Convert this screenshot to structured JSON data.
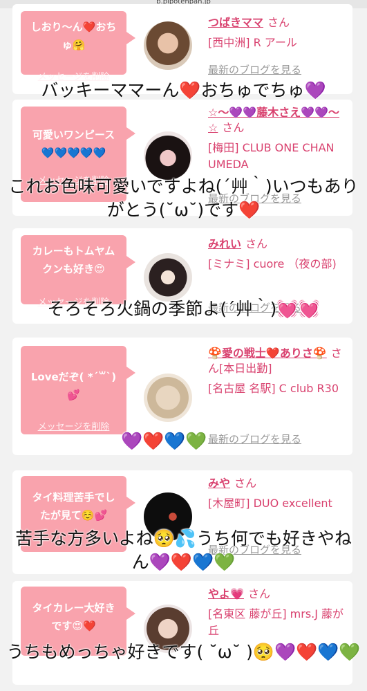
{
  "status": {
    "url_text": "b.pipotenpan.jp"
  },
  "blog_link_label": "最新のブログを見る",
  "delete_label": "メッセージを削除",
  "san_label": "さん",
  "cards": [
    {
      "message": "しおり〜ん❤️おちゅ🤗",
      "name": "つばきママ",
      "shop": "[西中洲] R アール",
      "overlay": "バッキーママーん❤️おちゅでちゅ💜"
    },
    {
      "message": "可愛いワンピース💙💙💙💙💙",
      "name": "☆〜💜💜藤木さえ💜💜〜☆",
      "shop": "[梅田] CLUB ONE CHAN UMEDA",
      "overlay": "これお色味可愛いですよね(´艸｀)いつもありがとう(˘ω˘)です❤️"
    },
    {
      "message": "カレーもトムヤムクンも好き😍",
      "name": "みれい",
      "shop": "[ミナミ] cuore （夜の部)",
      "overlay": "そろそろ火鍋の季節よ(´艸｀)💓💓"
    },
    {
      "message": "Loveだぞ( *´꒳`)💕",
      "name": "🍄愛の戦士❤️ありさ🍄",
      "name_suffix": "[本日出勤]",
      "shop": "[名古屋 名駅] C club R30",
      "overlay": "💜❤️💙💚"
    },
    {
      "message": "タイ料理苦手でしたが見て☺️💕",
      "name": "みや",
      "shop": "[木屋町] DUO excellent",
      "overlay": "苦手な方多いよね🥺💦うち何でも好きやねん💜❤️💙💚"
    },
    {
      "message": "タイカレー大好きです😍❤️",
      "name": "やよ💗",
      "shop": "[名東区 藤が丘] mrs.J 藤が丘",
      "overlay": "うちもめっちゃ好きです( ˘ω˘ )🥺💜❤️💙💚"
    }
  ]
}
